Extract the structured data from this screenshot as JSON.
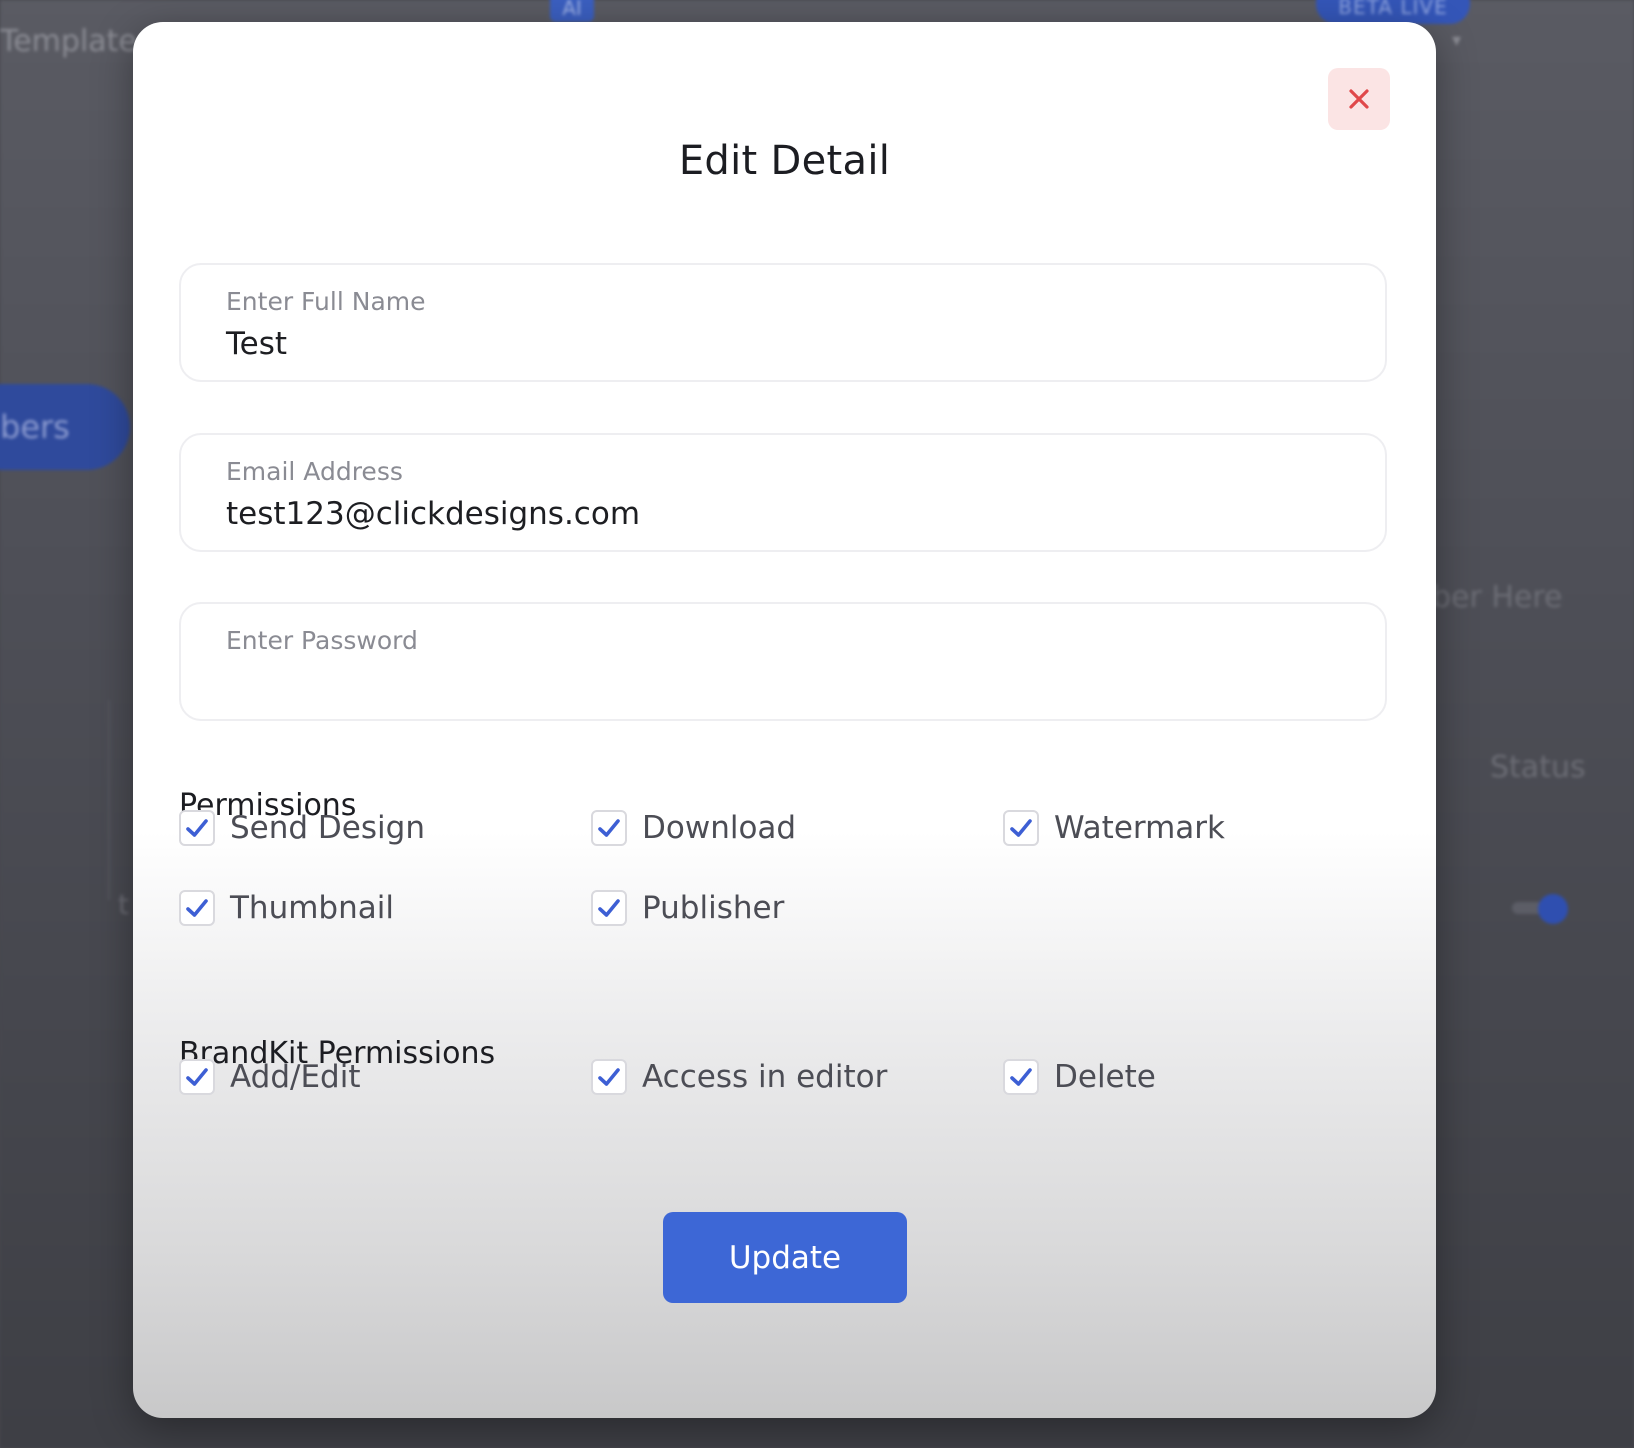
{
  "background": {
    "templates_label": "Templates",
    "ai_badge": "AI",
    "beta_badge": "BETA LIVE",
    "members_label": "bers",
    "search_hint": "ber Here",
    "status_label": "Status",
    "row_text": "t"
  },
  "modal": {
    "title": "Edit Detail",
    "close_icon": "close-icon",
    "fields": {
      "full_name": {
        "label": "Enter Full Name",
        "value": "Test"
      },
      "email": {
        "label": "Email Address",
        "value": "test123@clickdesigns.com"
      },
      "password": {
        "label": "Enter Password",
        "value": ""
      }
    },
    "permissions": {
      "title": "Permissions",
      "items": [
        {
          "label": "Send Design",
          "checked": true
        },
        {
          "label": "Download",
          "checked": true
        },
        {
          "label": "Watermark",
          "checked": true
        },
        {
          "label": "Thumbnail",
          "checked": true
        },
        {
          "label": "Publisher",
          "checked": true
        }
      ]
    },
    "brandkit_permissions": {
      "title": "BrandKit Permissions",
      "items": [
        {
          "label": "Add/Edit",
          "checked": true
        },
        {
          "label": "Access in editor",
          "checked": true
        },
        {
          "label": "Delete",
          "checked": true
        }
      ]
    },
    "update_label": "Update"
  },
  "colors": {
    "accent": "#3d67d6",
    "check": "#3d5fd4",
    "close": "#e0484a",
    "close_bg": "#fbe4e4"
  }
}
